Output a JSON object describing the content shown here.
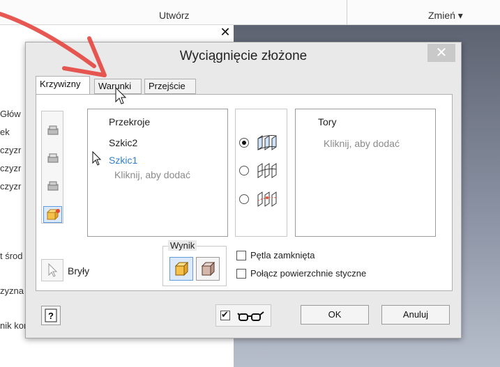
{
  "ribbon": {
    "group_create": "Utwórz",
    "group_modify": "Zmień ▾"
  },
  "background": {
    "browser_items": [
      "Głów",
      "ek",
      "czyzr",
      "czyzr",
      "czyzr",
      "t środ",
      "zyzna",
      "nik koń"
    ]
  },
  "dialog": {
    "title": "Wyciągnięcie złożone",
    "close_glyph": "✕",
    "tabs": [
      "Krzywizny",
      "Warunki",
      "Przejście"
    ],
    "active_tab": "Krzywizny",
    "sections_label": "Przekroje",
    "sections": [
      {
        "label": "Szkic2",
        "selected": false
      },
      {
        "label": "Szkic1",
        "selected": true
      }
    ],
    "sections_hint": "Kliknij, aby dodać",
    "rails_label": "Tory",
    "rails_hint": "Kliknij, aby dodać",
    "type_options_selected": 0,
    "solids_label": "Bryły",
    "result_label": "Wynik",
    "closed_loop_label": "Pętla zamknięta",
    "merge_tangent_label": "Połącz powierzchnie styczne",
    "closed_loop_checked": false,
    "merge_tangent_checked": false,
    "preview_checked": true,
    "ok_label": "OK",
    "cancel_label": "Anuluj"
  },
  "colors": {
    "accent_blue": "#2e7fd2",
    "annotation_arrow": "#e5463f"
  }
}
